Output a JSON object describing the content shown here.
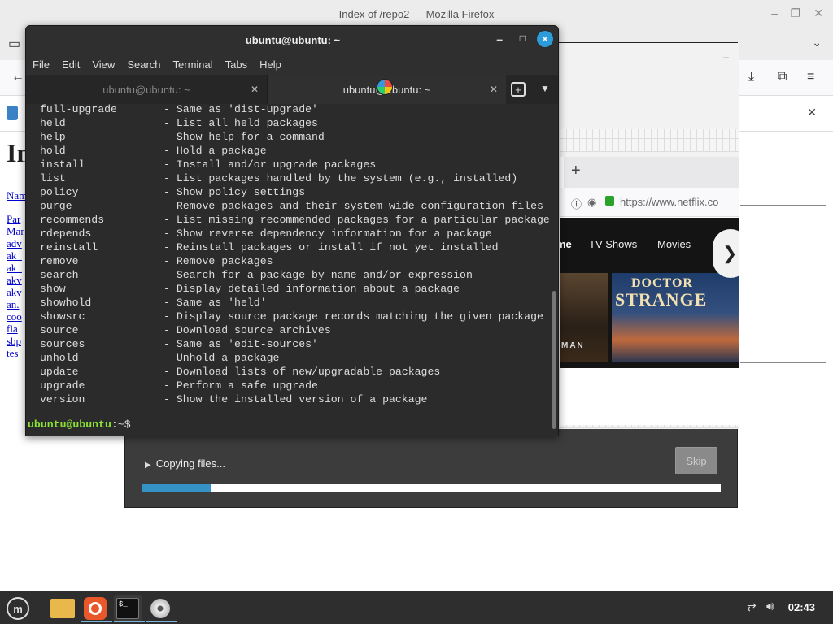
{
  "firefox": {
    "window_title": "Index of /repo2 — Mozilla Firefox",
    "heading": "In",
    "links": [
      "Nam",
      "Par",
      "Mar",
      "adv",
      "ak_",
      "ak_",
      "akv",
      "akv",
      "an.",
      "coo",
      "fla",
      "sbp",
      "tes"
    ]
  },
  "slideshow": {
    "url": "https://www.netflix.co",
    "nav": [
      "me",
      "TV Shows",
      "Movies"
    ],
    "poster_title_top": "DOCTOR",
    "poster_title_bottom": "STRANGE",
    "poster_left_text": "MAN"
  },
  "copy_dialog": {
    "status": "Copying files...",
    "skip_label": "Skip",
    "progress": 0.12
  },
  "terminal": {
    "title": "ubuntu@ubuntu: ~",
    "menu": [
      "File",
      "Edit",
      "View",
      "Search",
      "Terminal",
      "Tabs",
      "Help"
    ],
    "tabs": [
      "ubuntu@ubuntu: ~",
      "ubuntu@ubuntu: ~"
    ],
    "commands": [
      {
        "cmd": "full-upgrade",
        "desc": "- Same as 'dist-upgrade'"
      },
      {
        "cmd": "held",
        "desc": "- List all held packages"
      },
      {
        "cmd": "help",
        "desc": "- Show help for a command"
      },
      {
        "cmd": "hold",
        "desc": "- Hold a package"
      },
      {
        "cmd": "install",
        "desc": "- Install and/or upgrade packages"
      },
      {
        "cmd": "list",
        "desc": "- List packages handled by the system (e.g., installed)"
      },
      {
        "cmd": "policy",
        "desc": "- Show policy settings"
      },
      {
        "cmd": "purge",
        "desc": "- Remove packages and their system-wide configuration files"
      },
      {
        "cmd": "recommends",
        "desc": "- List missing recommended packages for a particular package"
      },
      {
        "cmd": "rdepends",
        "desc": "- Show reverse dependency information for a package"
      },
      {
        "cmd": "reinstall",
        "desc": "- Reinstall packages or install if not yet installed"
      },
      {
        "cmd": "remove",
        "desc": "- Remove packages"
      },
      {
        "cmd": "search",
        "desc": "- Search for a package by name and/or expression"
      },
      {
        "cmd": "show",
        "desc": "- Display detailed information about a package"
      },
      {
        "cmd": "showhold",
        "desc": "- Same as 'held'"
      },
      {
        "cmd": "showsrc",
        "desc": "- Display source package records matching the given package"
      },
      {
        "cmd": "source",
        "desc": "- Download source archives"
      },
      {
        "cmd": "sources",
        "desc": "- Same as 'edit-sources'"
      },
      {
        "cmd": "unhold",
        "desc": "- Unhold a package"
      },
      {
        "cmd": "update",
        "desc": "- Download lists of new/upgradable packages"
      },
      {
        "cmd": "upgrade",
        "desc": "- Perform a safe upgrade"
      },
      {
        "cmd": "version",
        "desc": "- Show the installed version of a package"
      }
    ],
    "prompt_user": "ubuntu@ubuntu",
    "prompt_path": ":~$",
    "prompt_color": "#8ae234"
  },
  "taskbar": {
    "time": "02:43"
  }
}
